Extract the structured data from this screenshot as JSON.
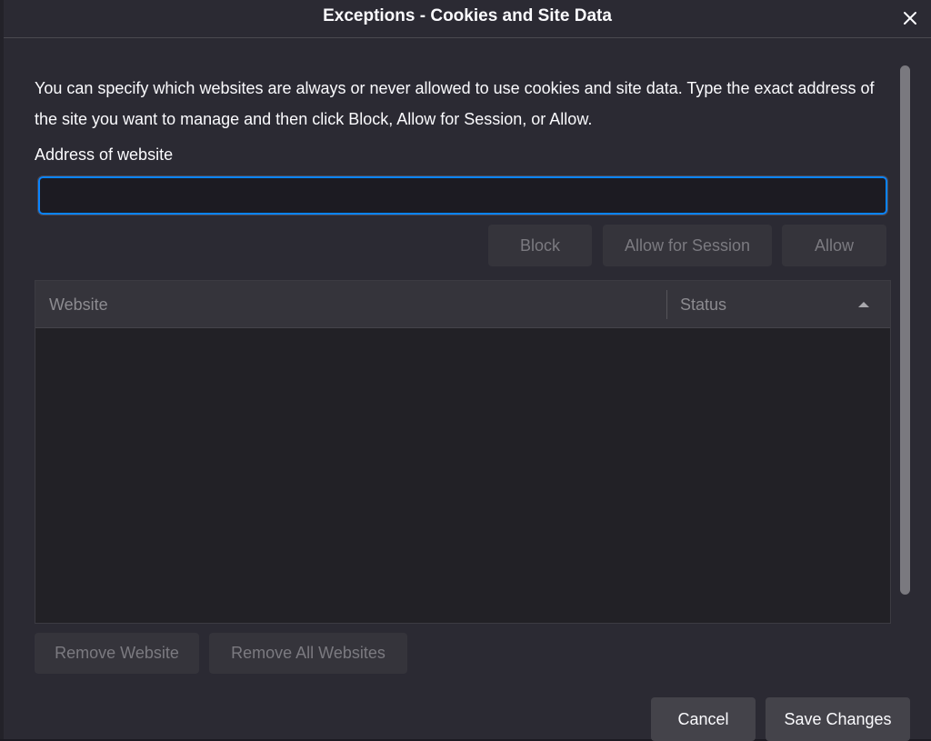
{
  "dialog": {
    "title": "Exceptions - Cookies and Site Data",
    "close_icon": "close-icon",
    "description": "You can specify which websites are always or never allowed to use cookies and site data. Type the exact address of the site you want to manage and then click Block, Allow for Session, or Allow.",
    "address_label": "Address of website",
    "address_value": "",
    "buttons": {
      "block": "Block",
      "allow_session": "Allow for Session",
      "allow": "Allow",
      "remove_website": "Remove Website",
      "remove_all": "Remove All Websites",
      "cancel": "Cancel",
      "save": "Save Changes"
    },
    "table": {
      "columns": [
        "Website",
        "Status"
      ],
      "sort_icon": "sort-ascending-icon",
      "rows": []
    }
  },
  "colors": {
    "background": "#2b2a33",
    "accent": "#0a84ff",
    "text": "#fbfbfe",
    "disabled_text": "#7b7a80"
  }
}
